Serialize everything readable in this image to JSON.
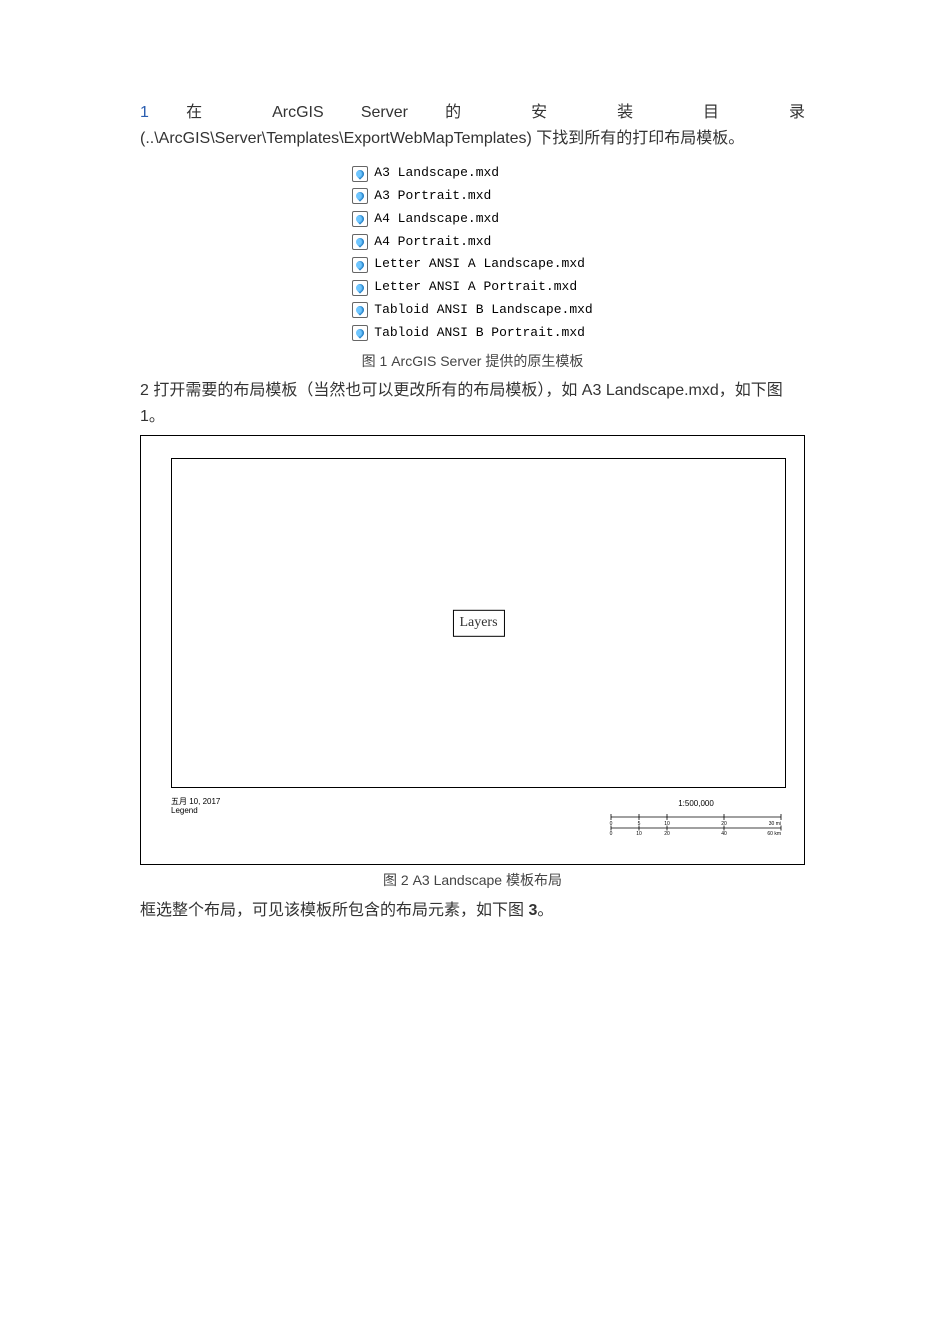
{
  "para1": {
    "num": "1",
    "text_parts": [
      "在",
      "ArcGIS",
      "Server",
      "的",
      "安",
      "装",
      "目",
      "录"
    ]
  },
  "para2": "(..\\ArcGIS\\Server\\Templates\\ExportWebMapTemplates) 下找到所有的打印布局模板。",
  "file_list": [
    "A3 Landscape.mxd",
    "A3 Portrait.mxd",
    "A4 Landscape.mxd",
    "A4 Portrait.mxd",
    "Letter ANSI A Landscape.mxd",
    "Letter ANSI A Portrait.mxd",
    "Tabloid ANSI B Landscape.mxd",
    "Tabloid ANSI B Portrait.mxd"
  ],
  "caption1": "图 1 ArcGIS Server 提供的原生模板",
  "para3_num": "2",
  "para3_text": " 打开需要的布局模板（当然也可以更改所有的布局模板），如 A3 Landscape.mxd，如下图 1。",
  "layout": {
    "layers_label": "Layers",
    "date_line": "五月 10, 2017",
    "legend_line": "Legend",
    "scale_text": "1:500,000",
    "scale_ticks_top": [
      "0",
      "5",
      "10",
      "20",
      "30 mi"
    ],
    "scale_ticks_bottom": [
      "0",
      "10",
      "20",
      "40",
      "60 km"
    ]
  },
  "caption2": "图 2 A3 Landscape 模板布局",
  "para4_a": "框选整个布局，可见该模板所包含的布局元素，如下图 ",
  "para4_num": "3",
  "para4_b": "。"
}
